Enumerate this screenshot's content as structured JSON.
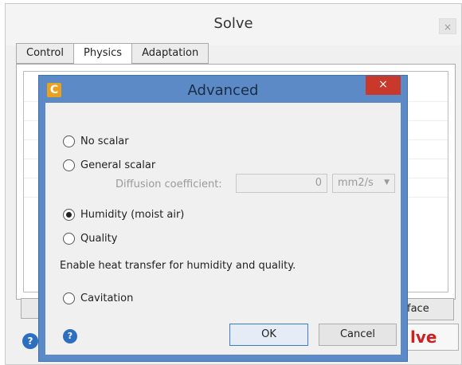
{
  "solve_window": {
    "title": "Solve",
    "close_glyph": "×",
    "tabs": [
      {
        "label": "Control",
        "active": false
      },
      {
        "label": "Physics",
        "active": true
      },
      {
        "label": "Adaptation",
        "active": false
      }
    ],
    "right_button_label": "face",
    "solve_button_label": "lve",
    "help_icon": "help-icon"
  },
  "advanced_dialog": {
    "title": "Advanced",
    "app_icon_glyph": "C",
    "close_glyph": "×",
    "options": {
      "no_scalar": {
        "label": "No scalar",
        "checked": false
      },
      "general_scalar": {
        "label": "General scalar",
        "checked": false
      },
      "humidity": {
        "label": "Humidity (moist air)",
        "checked": true
      },
      "quality": {
        "label": "Quality",
        "checked": false
      },
      "cavitation": {
        "label": "Cavitation",
        "checked": false
      }
    },
    "diffusion": {
      "label": "Diffusion coefficient:",
      "value": "0",
      "unit": "mm2/s"
    },
    "hint": "Enable heat transfer for humidity and quality.",
    "ok_label": "OK",
    "cancel_label": "Cancel",
    "help_glyph": "?"
  },
  "colors": {
    "dialog_frame": "#5b8ac7",
    "close_button": "#c8392b",
    "solve_text": "#cc1f1f",
    "help_icon": "#2c6fc0"
  }
}
